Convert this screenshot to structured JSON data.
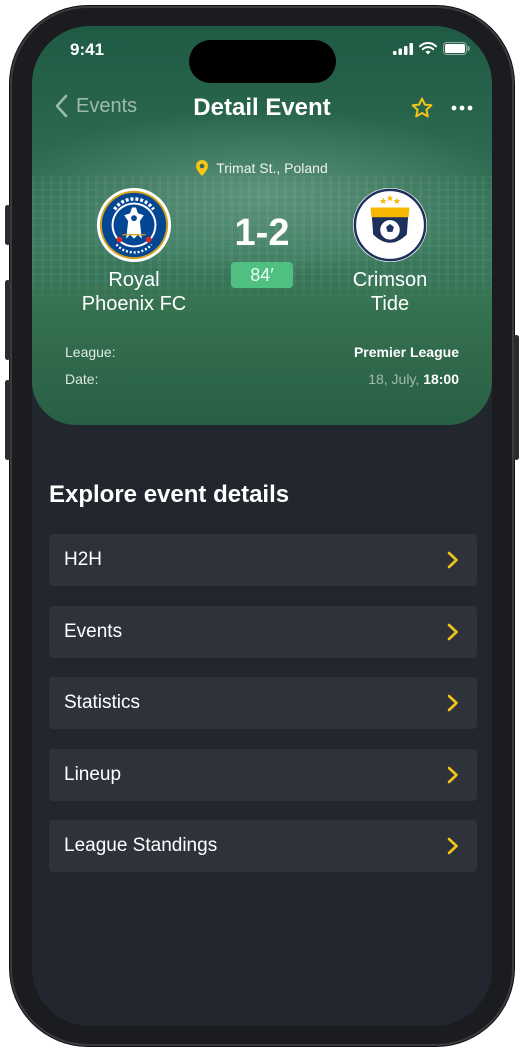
{
  "status_bar": {
    "time": "9:41"
  },
  "nav": {
    "back_label": "Events",
    "title": "Detail Event"
  },
  "match": {
    "location": "Trimat St., Poland",
    "home_team": {
      "line1": "Royal",
      "line2": "Phoenix FC",
      "crest": "chelsea-crest"
    },
    "away_team": {
      "line1": "Crimson",
      "line2": "Tide",
      "crest": "football-club-crest"
    },
    "score": "1-2",
    "minute": "84′",
    "league_label": "League:",
    "league_value": "Premier League",
    "date_label": "Date:",
    "date_day": "18, July,",
    "date_time": "18:00"
  },
  "section": {
    "title": "Explore event details"
  },
  "menu": [
    {
      "label": "H2H"
    },
    {
      "label": "Events"
    },
    {
      "label": "Statistics"
    },
    {
      "label": "Lineup"
    },
    {
      "label": "League Standings"
    }
  ],
  "colors": {
    "accent": "#f5c518",
    "hero_green": "#2e6b52",
    "minute_badge": "#4fbf82",
    "background": "#22262e",
    "card": "#2e323b"
  },
  "icons": {
    "back": "chevron-left-icon",
    "favorite": "star-icon",
    "more": "more-horizontal-icon",
    "location": "location-pin-icon",
    "row_chevron": "chevron-right-icon"
  }
}
